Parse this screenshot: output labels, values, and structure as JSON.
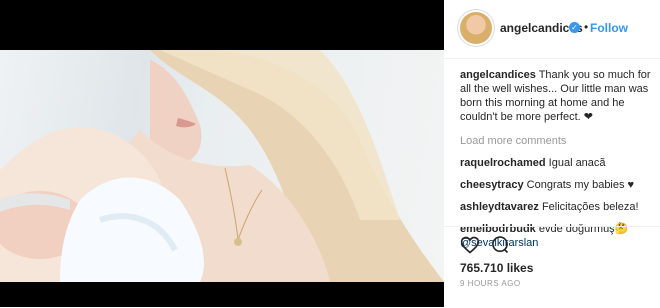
{
  "post": {
    "username": "angelcandices",
    "follow_label": "Follow",
    "dot": "•",
    "verified_check": "✓",
    "caption_user": "angelcandices",
    "caption_text": "Thank you so much for all the well wishes... Our little man was born this morning at home and he couldn't be more perfect. ❤",
    "load_more": "Load more comments",
    "comments": [
      {
        "user": "raquelrochamed",
        "text": "Igual anacã"
      },
      {
        "user": "cheesytracy",
        "text": "Congrats my babies ♥"
      },
      {
        "user": "ashleydtavarez",
        "text": "Felicitações beleza!"
      },
      {
        "user": "emelbodrbudk",
        "text": "evde doğurmuş🤔",
        "mention": "@sevalkirarslan"
      }
    ],
    "likes": "765.710 likes",
    "time": "9 HOURS AGO"
  },
  "icons": {
    "like": "heart-icon",
    "comment": "comment-icon",
    "save": "bookmark-icon"
  }
}
